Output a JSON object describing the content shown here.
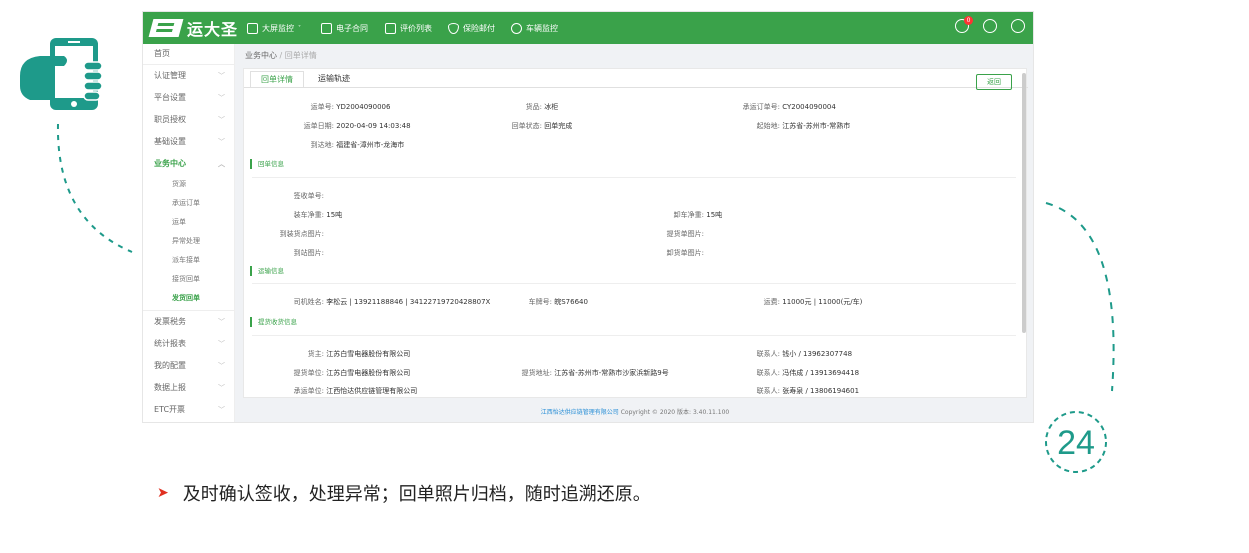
{
  "clock_number": "24",
  "app": {
    "brand": "运大圣",
    "nav": [
      "大屏监控",
      "电子合同",
      "评价列表",
      "保险邮付",
      "车辆监控"
    ],
    "notification_count": "0"
  },
  "sidebar": {
    "items": [
      {
        "label": "首页"
      },
      {
        "label": "认证管理"
      },
      {
        "label": "平台设置"
      },
      {
        "label": "职员授权"
      },
      {
        "label": "基础设置"
      },
      {
        "label": "业务中心"
      },
      {
        "label": "发票税务"
      },
      {
        "label": "统计报表"
      },
      {
        "label": "我的配置"
      },
      {
        "label": "数据上报"
      },
      {
        "label": "ETC开票"
      }
    ],
    "sub_items": [
      "货源",
      "承运订单",
      "运单",
      "异常处理",
      "派车接单",
      "接货回单",
      "发货回单"
    ]
  },
  "breadcrumb": {
    "root": "业务中心",
    "sep": "/",
    "current": "回单详情"
  },
  "tabs": [
    "回单详情",
    "运输轨迹"
  ],
  "back_label": "返回",
  "waybill": {
    "no_label": "运单号:",
    "no": "YD2004090006",
    "goods_label": "货品:",
    "goods": "冰柜",
    "order_label": "承运订单号:",
    "order": "CY2004090004",
    "date_label": "运单日期:",
    "date": "2020-04-09 14:03:48",
    "status_label": "回单状态:",
    "status": "回单完成",
    "origin_label": "起始地:",
    "origin": "江苏省-苏州市-常熟市",
    "dest_label": "到达地:",
    "dest": "福建省-漳州市-龙海市"
  },
  "section_receipt": "回单信息",
  "receipt": {
    "sign_label": "签收单号:",
    "sign": "",
    "load_weight_label": "装车净重:",
    "load_weight": "15吨",
    "unload_weight_label": "卸车净重:",
    "unload_weight": "15吨",
    "load_img_label": "到装货点图片:",
    "pickup_img_label": "提货单图片:",
    "arrive_img_label": "到站图片:",
    "unload_img_label": "卸货单图片:"
  },
  "section_transport": "运输信息",
  "transport": {
    "driver_label": "司机姓名:",
    "driver": "李松云 | 13921188846 | 34122719720428807X",
    "plate_label": "车牌号:",
    "plate": "皖S76640",
    "fee_label": "运费:",
    "fee": "11000元 | 11000(元/车)"
  },
  "section_party": "提货收货信息",
  "party": {
    "shipper_label": "货主:",
    "shipper": "江苏白雪电器股份有限公司",
    "contact1_label": "联系人:",
    "contact1": "钱小 / 13962307748",
    "pickup_label": "提货单位:",
    "pickup": "江苏白雪电器股份有限公司",
    "pickup_addr_label": "提货地址:",
    "pickup_addr": "江苏省-苏州市-常熟市沙家浜新路9号",
    "contact2_label": "联系人:",
    "contact2": "冯伟成 / 13913694418",
    "carrier_label": "承运单位:",
    "carrier": "江西怡达供应链管理有限公司",
    "contact3_label": "联系人:",
    "contact3": "张寿泉 / 13806194601"
  },
  "footer": {
    "company": "江西怡达供应链管理有限公司",
    "copy": " Copyright © 2020 版本: 3.40.11.100"
  },
  "caption": "及时确认签收，处理异常；回单照片归档，随时追溯还原。",
  "colors": {
    "brand_green": "#3aa24a",
    "teal": "#1e9a8a",
    "arrow_red": "#e03020"
  }
}
